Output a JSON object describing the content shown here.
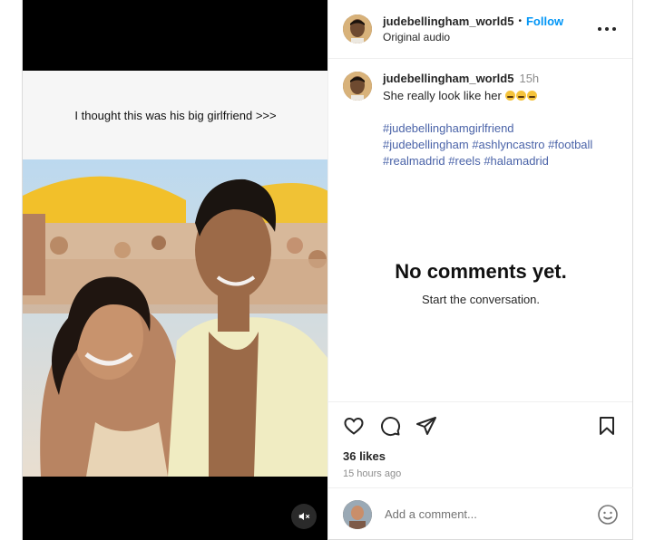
{
  "post": {
    "media": {
      "overlay_text": "I thought this was his big girlfriend >>>",
      "mute_icon": "speaker-muted-icon"
    },
    "header": {
      "username": "judebellingham_world5",
      "separator": "•",
      "follow_label": "Follow",
      "audio_label": "Original audio",
      "more_icon": "more-options-icon"
    },
    "caption": {
      "username": "judebellingham_world5",
      "time": "15h",
      "message": "She really look like her",
      "hashtags": [
        "#judebellinghamgirlfriend",
        "#judebellingham",
        "#ashlyncastro",
        "#football",
        "#realmadrid",
        "#reels",
        "#halamadrid"
      ]
    },
    "comments": {
      "empty_title": "No comments yet.",
      "empty_subtitle": "Start the conversation."
    },
    "actions": {
      "likes": "36 likes",
      "time_ago": "15 hours ago"
    },
    "comment_bar": {
      "placeholder": "Add a comment..."
    }
  },
  "colors": {
    "link_blue": "#0095f6",
    "hashtag": "#4a63a8",
    "muted_text": "#8e8e8e"
  }
}
